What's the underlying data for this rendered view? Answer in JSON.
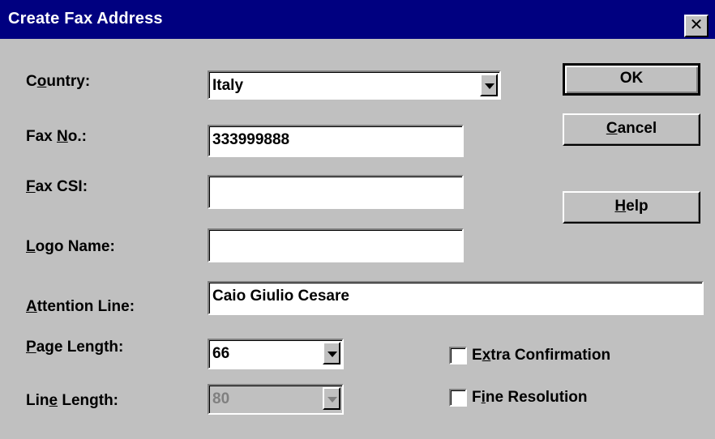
{
  "window": {
    "title": "Create Fax Address",
    "close_symbol": "✕"
  },
  "fields": {
    "country": {
      "label_pre": "C",
      "label_key": "o",
      "label_post": "untry:",
      "value": "Italy"
    },
    "fax_no": {
      "label_pre": "Fax ",
      "label_key": "N",
      "label_post": "o.:",
      "value": "333999888"
    },
    "fax_csi": {
      "label_pre": "",
      "label_key": "F",
      "label_post": "ax CSI:",
      "value": ""
    },
    "logo_name": {
      "label_pre": "",
      "label_key": "L",
      "label_post": "ogo Name:",
      "value": ""
    },
    "attention_line": {
      "label_pre": "",
      "label_key": "A",
      "label_post": "ttention Line:",
      "value": "Caio Giulio Cesare"
    },
    "page_length": {
      "label_pre": "",
      "label_key": "P",
      "label_post": "age Length:",
      "value": "66"
    },
    "line_length": {
      "label_pre": "Lin",
      "label_key": "e",
      "label_post": " Length:",
      "value": "80"
    }
  },
  "buttons": {
    "ok": {
      "pre": "OK",
      "key": "",
      "post": ""
    },
    "cancel": {
      "pre": "",
      "key": "C",
      "post": "ancel"
    },
    "help": {
      "pre": "",
      "key": "H",
      "post": "elp"
    }
  },
  "checkboxes": {
    "extra_confirmation": {
      "pre": "E",
      "key": "x",
      "post": "tra Confirmation",
      "checked": false
    },
    "fine_resolution": {
      "pre": "F",
      "key": "i",
      "post": "ne Resolution",
      "checked": false
    }
  }
}
